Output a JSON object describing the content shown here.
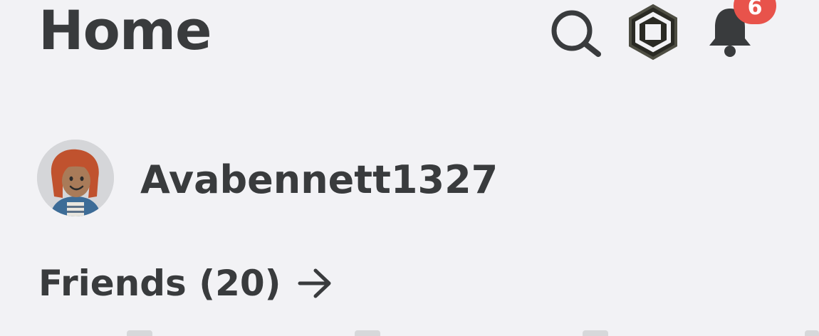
{
  "header": {
    "title": "Home",
    "icons": {
      "search": "search-icon",
      "robux": "robux-icon",
      "notifications": "bell-icon"
    },
    "notification_count": "6",
    "badge_color": "#e8534b"
  },
  "profile": {
    "username": "Avabennett1327",
    "avatar": "avatar"
  },
  "friends": {
    "label": "Friends (20)",
    "icon": "arrow-right-icon"
  },
  "colors": {
    "background": "#f2f2f5",
    "text": "#393b3d"
  }
}
